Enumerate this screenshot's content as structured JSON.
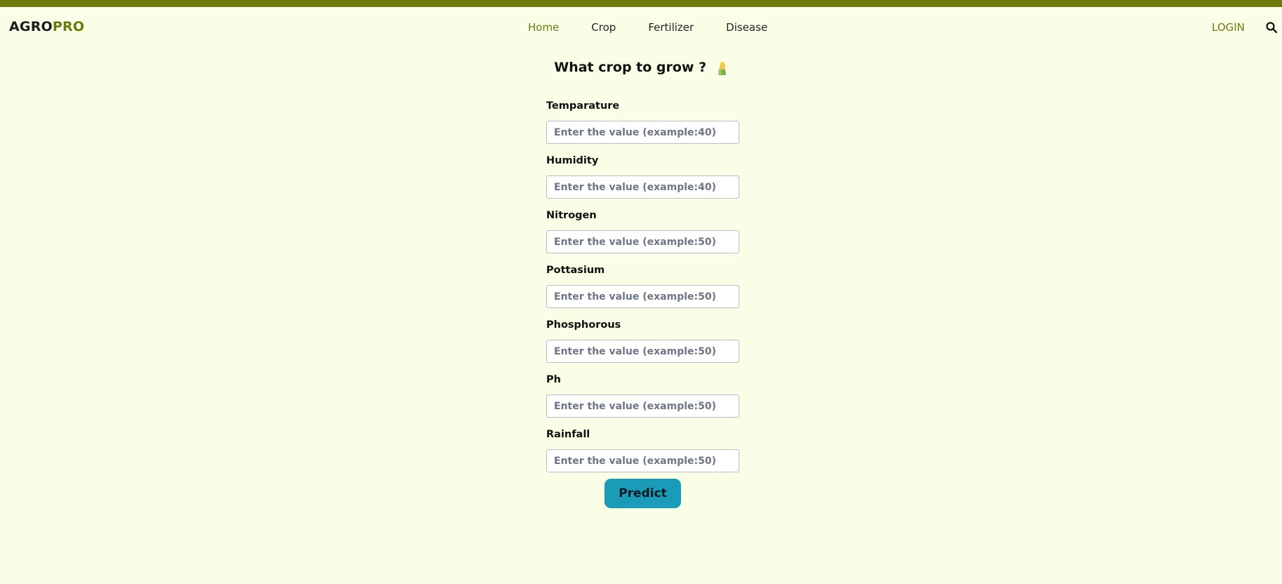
{
  "header": {
    "logo_part1": "AGRO",
    "logo_part2": "PRO",
    "nav": [
      {
        "label": "Home",
        "active": true
      },
      {
        "label": "Crop",
        "active": false
      },
      {
        "label": "Fertilizer",
        "active": false
      },
      {
        "label": "Disease",
        "active": false
      }
    ],
    "login_label": "LOGIN",
    "search_icon": "search-icon"
  },
  "page": {
    "title": "What crop to grow ?",
    "title_icon": "corn-icon"
  },
  "form": {
    "fields": [
      {
        "label": "Temparature",
        "placeholder": "Enter the value (example:40)"
      },
      {
        "label": "Humidity",
        "placeholder": "Enter the value (example:40)"
      },
      {
        "label": "Nitrogen",
        "placeholder": "Enter the value (example:50)"
      },
      {
        "label": "Pottasium",
        "placeholder": "Enter the value (example:50)"
      },
      {
        "label": "Phosphorous",
        "placeholder": "Enter the value (example:50)"
      },
      {
        "label": "Ph",
        "placeholder": "Enter the value (example:50)"
      },
      {
        "label": "Rainfall",
        "placeholder": "Enter the value (example:50)"
      }
    ],
    "submit_label": "Predict"
  },
  "colors": {
    "background": "#fafee6",
    "accent": "#6b7a0b",
    "button": "#1a9cb8"
  }
}
